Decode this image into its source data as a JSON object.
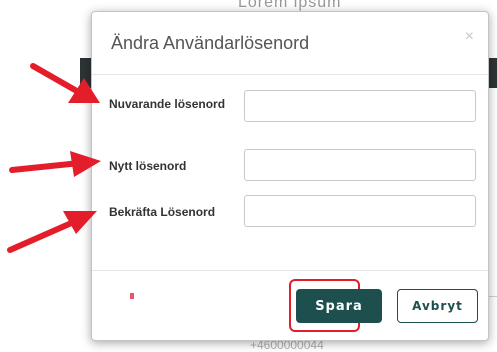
{
  "background": {
    "top_text": "Lorem ipsum",
    "bottom_text": "+4600000044"
  },
  "dialog": {
    "title": "Ändra Användarlösenord",
    "close_icon": "×",
    "fields": [
      {
        "label": "Nuvarande lösenord",
        "value": "",
        "placeholder": ""
      },
      {
        "label": "Nytt lösenord",
        "value": "",
        "placeholder": ""
      },
      {
        "label": "Bekräfta Lösenord",
        "value": "",
        "placeholder": ""
      }
    ],
    "save_label": "Spara",
    "cancel_label": "Avbryt"
  },
  "colors": {
    "primary": "#1d4f4f",
    "highlight": "#e31e2a",
    "arrow": "#e31e2a"
  }
}
